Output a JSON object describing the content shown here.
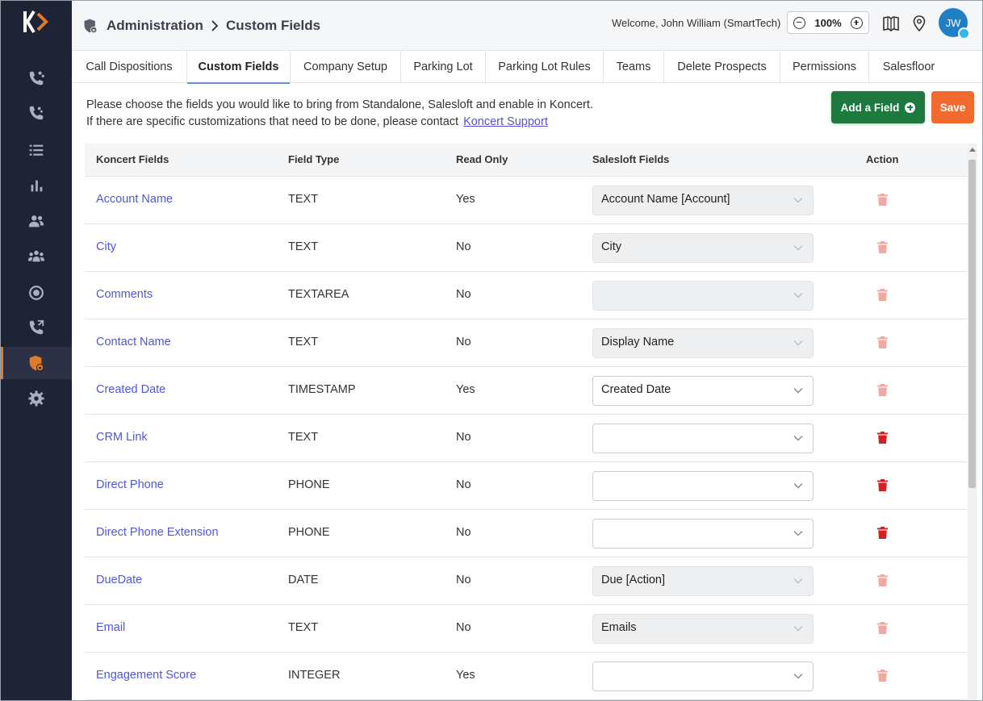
{
  "breadcrumb": {
    "section": "Administration",
    "page": "Custom Fields"
  },
  "header": {
    "welcome_prefix": "Welcome, John William",
    "org": "(SmartTech)",
    "zoom": "100%",
    "avatar_initials": "JW"
  },
  "tabs": [
    {
      "label": "Call Dispositions"
    },
    {
      "label": "Custom Fields"
    },
    {
      "label": "Company Setup"
    },
    {
      "label": "Parking Lot"
    },
    {
      "label": "Parking Lot Rules"
    },
    {
      "label": "Teams"
    },
    {
      "label": "Delete Prospects"
    },
    {
      "label": "Permissions"
    },
    {
      "label": "Salesfloor"
    }
  ],
  "active_tab": "Custom Fields",
  "info": {
    "line1": "Please choose the fields you would like to bring from Standalone, Salesloft and enable in Koncert.",
    "line2": "If there are specific customizations that need to be done, please contact",
    "link": "Koncert Support"
  },
  "buttons": {
    "add": "Add a Field",
    "save": "Save"
  },
  "table": {
    "columns": [
      "Koncert Fields",
      "Field Type",
      "Read Only",
      "Salesloft Fields",
      "Action"
    ],
    "rows": [
      {
        "name": "Account Name",
        "type": "TEXT",
        "read_only": "Yes",
        "salesloft": "Account Name [Account]",
        "select_disabled": true,
        "delete_enabled": false
      },
      {
        "name": "City",
        "type": "TEXT",
        "read_only": "No",
        "salesloft": "City",
        "select_disabled": true,
        "delete_enabled": false
      },
      {
        "name": "Comments",
        "type": "TEXTAREA",
        "read_only": "No",
        "salesloft": "",
        "select_disabled": true,
        "delete_enabled": false
      },
      {
        "name": "Contact Name",
        "type": "TEXT",
        "read_only": "No",
        "salesloft": "Display Name",
        "select_disabled": true,
        "delete_enabled": false
      },
      {
        "name": "Created Date",
        "type": "TIMESTAMP",
        "read_only": "Yes",
        "salesloft": "Created Date",
        "select_disabled": false,
        "delete_enabled": false
      },
      {
        "name": "CRM Link",
        "type": "TEXT",
        "read_only": "No",
        "salesloft": "",
        "select_disabled": false,
        "delete_enabled": true
      },
      {
        "name": "Direct Phone",
        "type": "PHONE",
        "read_only": "No",
        "salesloft": "",
        "select_disabled": false,
        "delete_enabled": true
      },
      {
        "name": "Direct Phone Extension",
        "type": "PHONE",
        "read_only": "No",
        "salesloft": "",
        "select_disabled": false,
        "delete_enabled": true
      },
      {
        "name": "DueDate",
        "type": "DATE",
        "read_only": "No",
        "salesloft": "Due [Action]",
        "select_disabled": true,
        "delete_enabled": false
      },
      {
        "name": "Email",
        "type": "TEXT",
        "read_only": "No",
        "salesloft": "Emails",
        "select_disabled": true,
        "delete_enabled": false
      },
      {
        "name": "Engagement Score",
        "type": "INTEGER",
        "read_only": "Yes",
        "salesloft": "",
        "select_disabled": false,
        "delete_enabled": false
      }
    ]
  },
  "sidebar": {
    "items": [
      {
        "icon": "phone-contacts-icon"
      },
      {
        "icon": "phone-incoming-icon"
      },
      {
        "icon": "list-icon"
      },
      {
        "icon": "bar-chart-icon"
      },
      {
        "icon": "users-icon"
      },
      {
        "icon": "team-icon"
      },
      {
        "icon": "record-icon"
      },
      {
        "icon": "phone-forward-icon"
      },
      {
        "icon": "admin-shield-icon",
        "active": true
      },
      {
        "icon": "gear-icon"
      }
    ]
  },
  "colors": {
    "sidebar": "#1e2336",
    "accent_orange": "#e07b2c",
    "link": "#4f57d6",
    "add_button": "#1c7a3e",
    "save_button": "#f26a2e",
    "trash_active": "#d42020",
    "trash_disabled": "#f0a8a2"
  }
}
